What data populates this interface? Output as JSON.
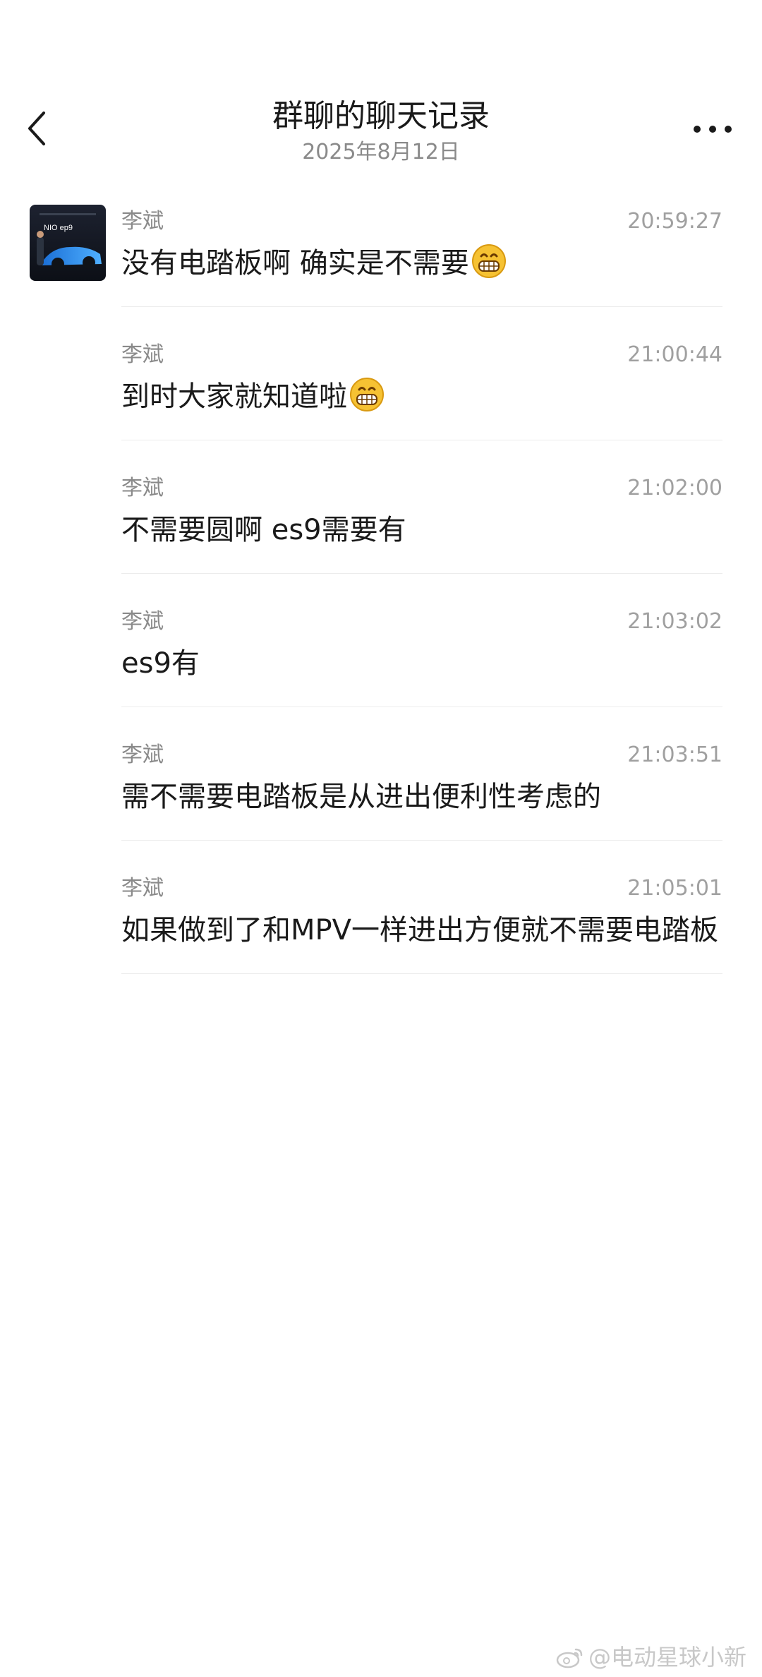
{
  "header": {
    "title": "群聊的聊天记录",
    "date": "2025年8月12日",
    "back_icon": "chevron-left-icon",
    "more_icon": "more-horizontal-icon"
  },
  "avatar": {
    "badge_text": "NIO ep9"
  },
  "messages": [
    {
      "sender": "李斌",
      "time": "20:59:27",
      "text": "没有电踏板啊 确实是不需要",
      "emoji": "grinning-emoji"
    },
    {
      "sender": "李斌",
      "time": "21:00:44",
      "text": "到时大家就知道啦",
      "emoji": "grinning-emoji"
    },
    {
      "sender": "李斌",
      "time": "21:02:00",
      "text": "不需要圆啊 es9需要有",
      "emoji": ""
    },
    {
      "sender": "李斌",
      "time": "21:03:02",
      "text": "es9有",
      "emoji": ""
    },
    {
      "sender": "李斌",
      "time": "21:03:51",
      "text": "需不需要电踏板是从进出便利性考虑的",
      "emoji": ""
    },
    {
      "sender": "李斌",
      "time": "21:05:01",
      "text": "如果做到了和MPV一样进出方便就不需要电踏板",
      "emoji": ""
    }
  ],
  "watermark": {
    "text": "@电动星球小新",
    "icon": "weibo-icon"
  },
  "colors": {
    "text": "#1a1a1a",
    "muted": "#8a8a8a",
    "divider": "#ececec",
    "emoji_face": "#f6c233"
  }
}
